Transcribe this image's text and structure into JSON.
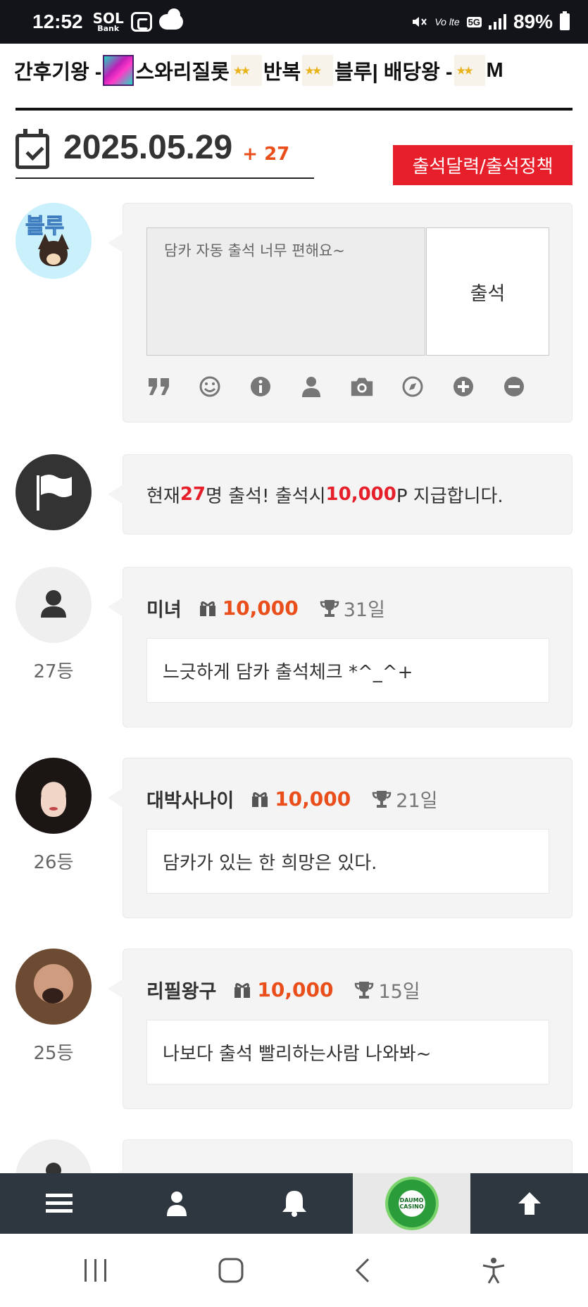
{
  "status_bar": {
    "time": "12:52",
    "sol_top": "SOL",
    "sol_bottom": "Bank",
    "net": "Vo lte",
    "g5": "5G",
    "battery": "89%"
  },
  "ranking": {
    "segments": [
      "간후기왕 - ",
      "스와리질롯",
      "반복",
      "블루",
      " | 배당왕 - ",
      "M"
    ]
  },
  "date": {
    "value": "2025.05.29",
    "count": "+ 27"
  },
  "policy_button": "출석달력/출석정책",
  "form": {
    "avatar_label": "블루",
    "placeholder": "담카 자동 출석 너무 편해요~",
    "submit": "출석"
  },
  "info": {
    "prefix": "현재 ",
    "count": "27",
    "mid": "명 출석! 출석시 ",
    "points": "10,000",
    "suffix": "P 지급합니다."
  },
  "entries": [
    {
      "nick": "미녀",
      "points": "10,000",
      "days": "31일",
      "message": "느긋하게 담카 출석체크 *^_^+",
      "rank": "27등"
    },
    {
      "nick": "대박사나이",
      "points": "10,000",
      "days": "21일",
      "message": "담카가 있는 한 희망은 있다.",
      "rank": "26등"
    },
    {
      "nick": "리필왕구",
      "points": "10,000",
      "days": "15일",
      "message": "나보다 출석 빨리하는사람 나와봐~",
      "rank": "25등"
    }
  ],
  "bottom_nav": {
    "logo_text": "DAUMO CASINO"
  },
  "colors": {
    "accent_red": "#e61f2b",
    "points_orange": "#e94e1b",
    "nav_dark": "#2e3640"
  }
}
